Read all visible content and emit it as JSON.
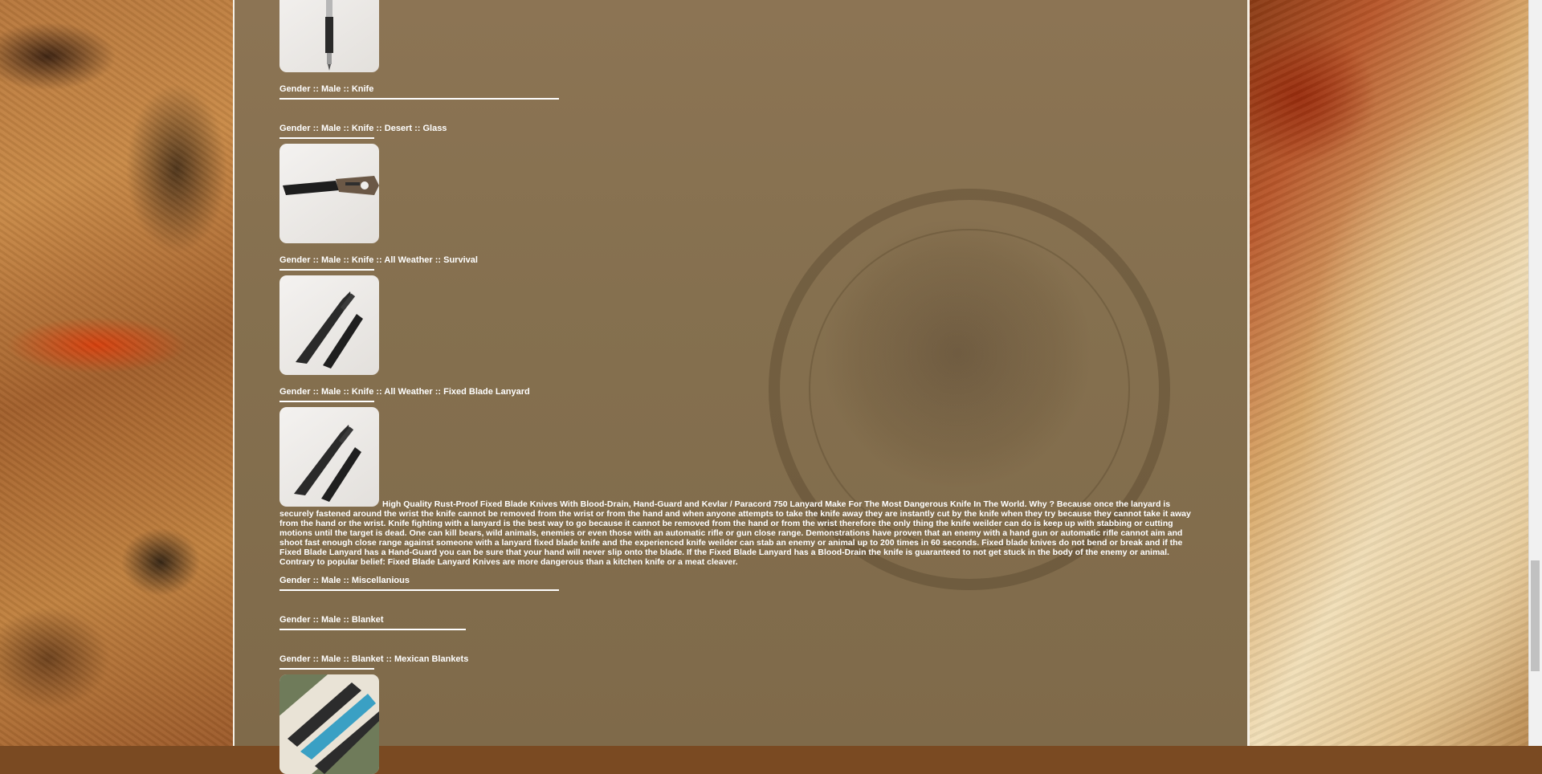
{
  "sections": [
    {
      "label": "Gender :: Male :: Knife"
    },
    {
      "label": "Gender :: Male :: Knife :: Desert :: Glass"
    },
    {
      "label": "Gender :: Male :: Knife :: All Weather :: Survival"
    },
    {
      "label": "Gender :: Male :: Knife :: All Weather :: Fixed Blade Lanyard"
    },
    {
      "label": "Gender :: Male :: Miscellanious"
    },
    {
      "label": "Gender :: Male :: Blanket"
    },
    {
      "label": "Gender :: Male :: Blanket :: Mexican Blankets"
    }
  ],
  "product_description": "High Quality Rust-Proof Fixed Blade Knives With Blood-Drain, Hand-Guard and Kevlar / Paracord 750 Lanyard Make For The Most Dangerous Knife In The World. Why ? Because once the lanyard is securely fastened around the wrist the knife cannot be removed from the wrist or from the hand and when anyone attempts to take the knife away they are instantly cut by the knife when they try because they cannot take it away from the hand or the wrist. Knife fighting with a lanyard is the best way to go because it cannot be removed from the hand or from the wrist therefore the only thing the knife weilder can do is keep up with stabbing or cutting motions until the target is dead. One can kill bears, wild animals, enemies or even those with an automatic rifle or gun close range. Demonstrations have proven that an enemy with a hand gun or automatic rifle cannot aim and shoot fast enough close range against someone with a lanyard fixed blade knife and the experienced knife weilder can stab an enemy or animal up to 200 times in 60 seconds. Fixed blade knives do not bend or break and if the Fixed Blade Lanyard has a Hand-Guard you can be sure that your hand will never slip onto the blade. If the Fixed Blade Lanyard has a Blood-Drain the knife is guaranteed to not get stuck in the body of the enemy or animal. Contrary to popular belief: Fixed Blade Lanyard Knives are more dangerous than a kitchen knife or a meat cleaver.",
  "icons": [
    "pen-image",
    "folding-knife-image",
    "survival-knife-image",
    "lanyard-knife-image",
    "mexican-blanket-image"
  ],
  "colors": {
    "text": "#ffffff",
    "panel": "#85704f",
    "thumb_bg": "#efedea"
  }
}
